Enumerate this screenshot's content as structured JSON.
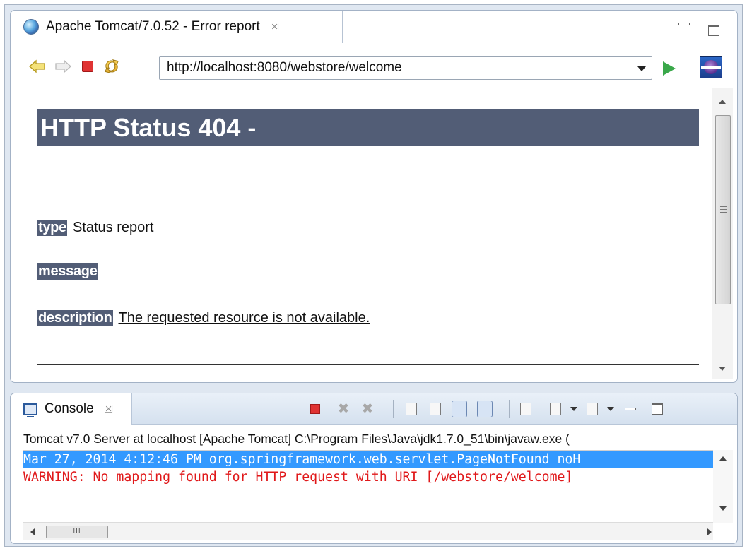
{
  "browser": {
    "tab_title": "Apache Tomcat/7.0.52 - Error report",
    "close_glyph": "☒",
    "url": "http://localhost:8080/webstore/welcome",
    "icons": {
      "tab": "globe-icon",
      "back": "back-arrow-icon",
      "forward": "forward-arrow-icon",
      "stop": "stop-icon",
      "refresh": "refresh-icon",
      "go": "go-icon",
      "eclipse": "eclipse-icon"
    }
  },
  "page": {
    "heading": "HTTP Status 404 -",
    "heading_bg": "#525d76",
    "type_label": "type",
    "type_value": "Status report",
    "message_label": "message",
    "message_value": "",
    "description_label": "description",
    "description_value": "The requested resource is not available."
  },
  "console": {
    "tab_title": "Console",
    "close_glyph": "☒",
    "server_line": "Tomcat v7.0 Server at localhost [Apache Tomcat] C:\\Program Files\\Java\\jdk1.7.0_51\\bin\\javaw.exe (",
    "lines": [
      "Mar 27, 2014 4:12:46 PM org.springframework.web.servlet.PageNotFound noH",
      "WARNING: No mapping found for HTTP request with URI [/webstore/welcome]"
    ],
    "highlight_color": "#3399ff",
    "warning_color": "#e0181a",
    "hscroll_grip": "III"
  }
}
